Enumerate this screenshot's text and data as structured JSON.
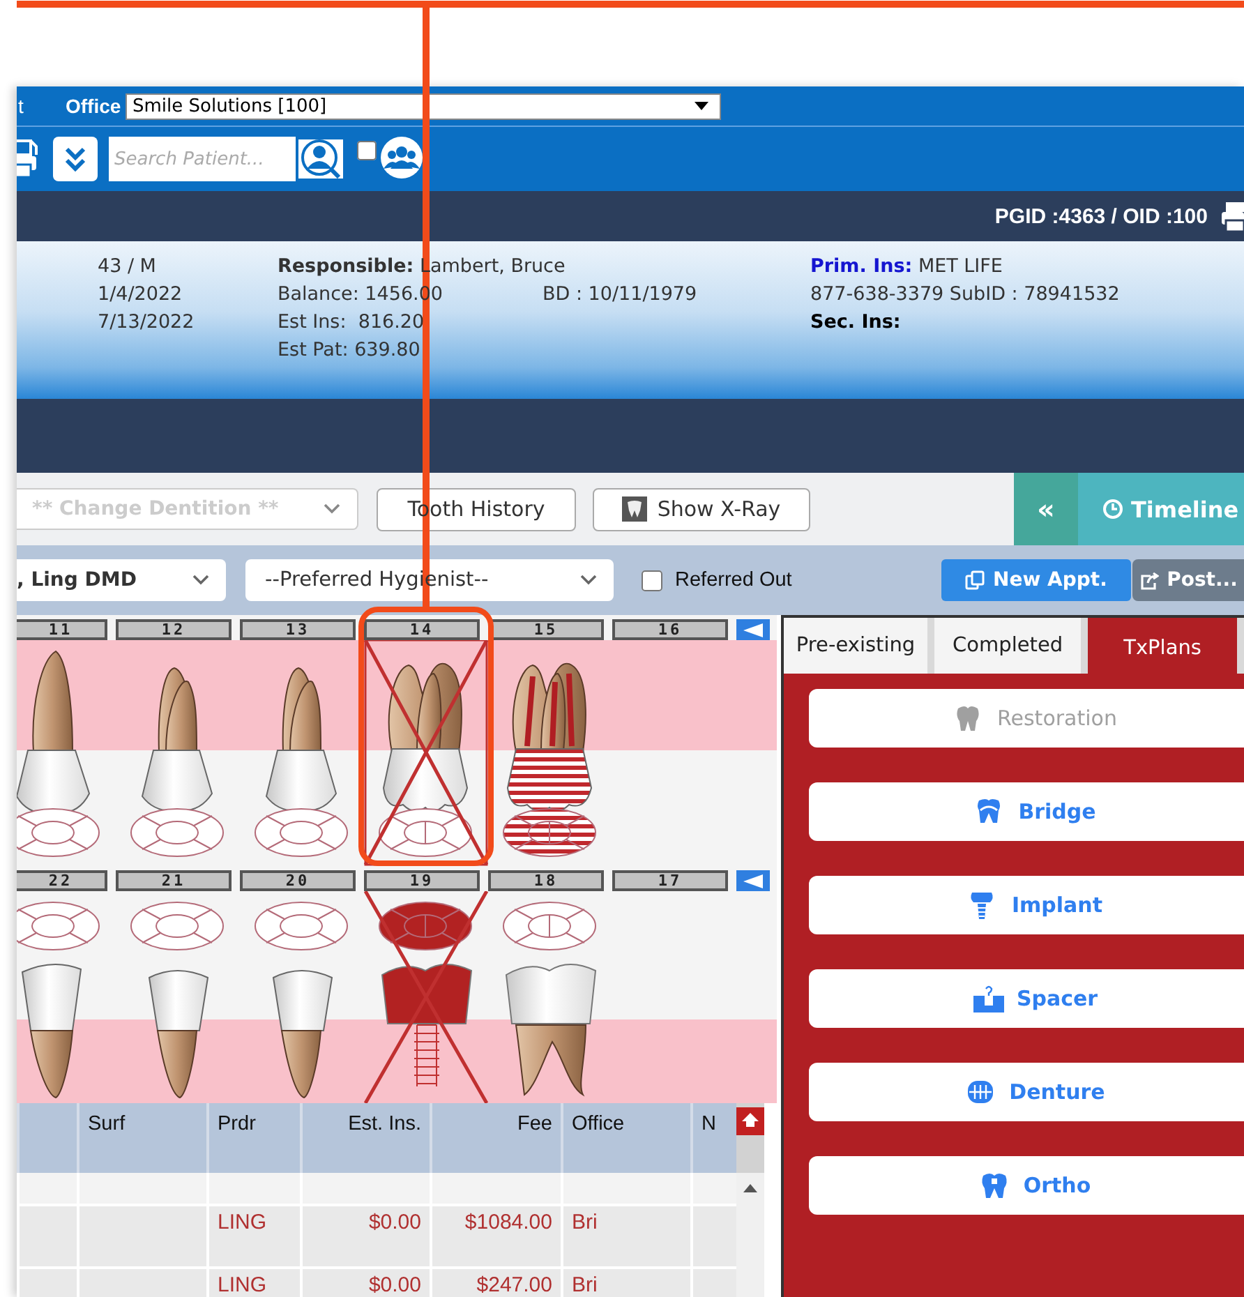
{
  "header": {
    "nav_fragment": "t",
    "office_label": "Office",
    "office_value": "Smile Solutions [100]",
    "search": {
      "placeholder": "Search Patient..."
    },
    "group_search_checked": false,
    "ids": "PGID :4363 / OID :100"
  },
  "patient": {
    "column_1": [
      "43 / M",
      "1/4/2022",
      "7/13/2022"
    ],
    "responsible_label": "Responsible:",
    "responsible_value": "Lambert, Bruce",
    "balance": "Balance: 1456.00",
    "birth_date": "BD : 10/11/1979",
    "est_ins": "Est Ins:  816.20",
    "est_pat": "Est Pat: 639.80",
    "prim_ins_label": "Prim. Ins:",
    "prim_ins_value": "MET LIFE",
    "insurance_line": "877-638-3379 SubID : 78941532",
    "sec_ins_label": "Sec. Ins:"
  },
  "toolbar": {
    "dentition": {
      "value": "** Change Dentition **",
      "disabled": true
    },
    "buttons": [
      {
        "label": "Tooth History"
      },
      {
        "label": "Show X-Ray"
      }
    ],
    "collapse": "«",
    "timeline": "Timeline"
  },
  "filters": {
    "provider": ", Ling DMD",
    "hygienist": "--Preferred Hygienist--",
    "referred_out": {
      "label": "Referred Out",
      "checked": false
    },
    "actions": [
      {
        "label": "New Appt.",
        "kind": "primary"
      },
      {
        "label": "Post...",
        "kind": "secondary"
      }
    ]
  },
  "chart": {
    "upper": [
      {
        "number": "11",
        "kind": "canine",
        "extraction": false,
        "crown_planned": false,
        "root_canal": false,
        "implant": false
      },
      {
        "number": "12",
        "kind": "premolar",
        "extraction": false,
        "crown_planned": false,
        "root_canal": false,
        "implant": false
      },
      {
        "number": "13",
        "kind": "premolar",
        "extraction": false,
        "crown_planned": false,
        "root_canal": false,
        "implant": false
      },
      {
        "number": "14",
        "kind": "molar",
        "extraction": true,
        "crown_planned": false,
        "root_canal": false,
        "implant": false
      },
      {
        "number": "15",
        "kind": "molar",
        "extraction": false,
        "crown_planned": true,
        "root_canal": true,
        "implant": false
      },
      {
        "number": "16",
        "kind": "missing"
      }
    ],
    "lower": [
      {
        "number": "22",
        "kind": "canine",
        "extraction": false,
        "crown_planned": false,
        "root_canal": false,
        "implant": false
      },
      {
        "number": "21",
        "kind": "premolar",
        "extraction": false,
        "crown_planned": false,
        "root_canal": false,
        "implant": false
      },
      {
        "number": "20",
        "kind": "premolar",
        "extraction": false,
        "crown_planned": false,
        "root_canal": false,
        "implant": false
      },
      {
        "number": "19",
        "kind": "molar",
        "extraction": true,
        "crown_planned": true,
        "root_canal": false,
        "implant": true
      },
      {
        "number": "18",
        "kind": "molar",
        "extraction": false,
        "crown_planned": false,
        "root_canal": false,
        "implant": false
      },
      {
        "number": "17",
        "kind": "missing"
      }
    ]
  },
  "table": {
    "columns": [
      "Surf",
      "Prdr",
      "Est. Ins.",
      "Fee",
      "Office",
      "N"
    ],
    "rows": [
      {
        "provider": "LING",
        "est_ins": "$0.00",
        "fee": "$1084.00",
        "office": "Bri"
      },
      {
        "provider": "LING",
        "est_ins": "$0.00",
        "fee": "$247.00",
        "office": "Bri"
      }
    ]
  },
  "tx_panel": {
    "tabs": [
      {
        "label": "Pre-existing",
        "selected": false
      },
      {
        "label": "Completed",
        "selected": false
      },
      {
        "label": "TxPlans",
        "selected": true
      }
    ],
    "buttons": [
      {
        "label": "Restoration",
        "disabled": true
      },
      {
        "label": "Bridge",
        "disabled": false
      },
      {
        "label": "Implant",
        "disabled": false
      },
      {
        "label": "Spacer",
        "disabled": false
      },
      {
        "label": "Denture",
        "disabled": false
      },
      {
        "label": "Ortho",
        "disabled": false
      }
    ]
  }
}
